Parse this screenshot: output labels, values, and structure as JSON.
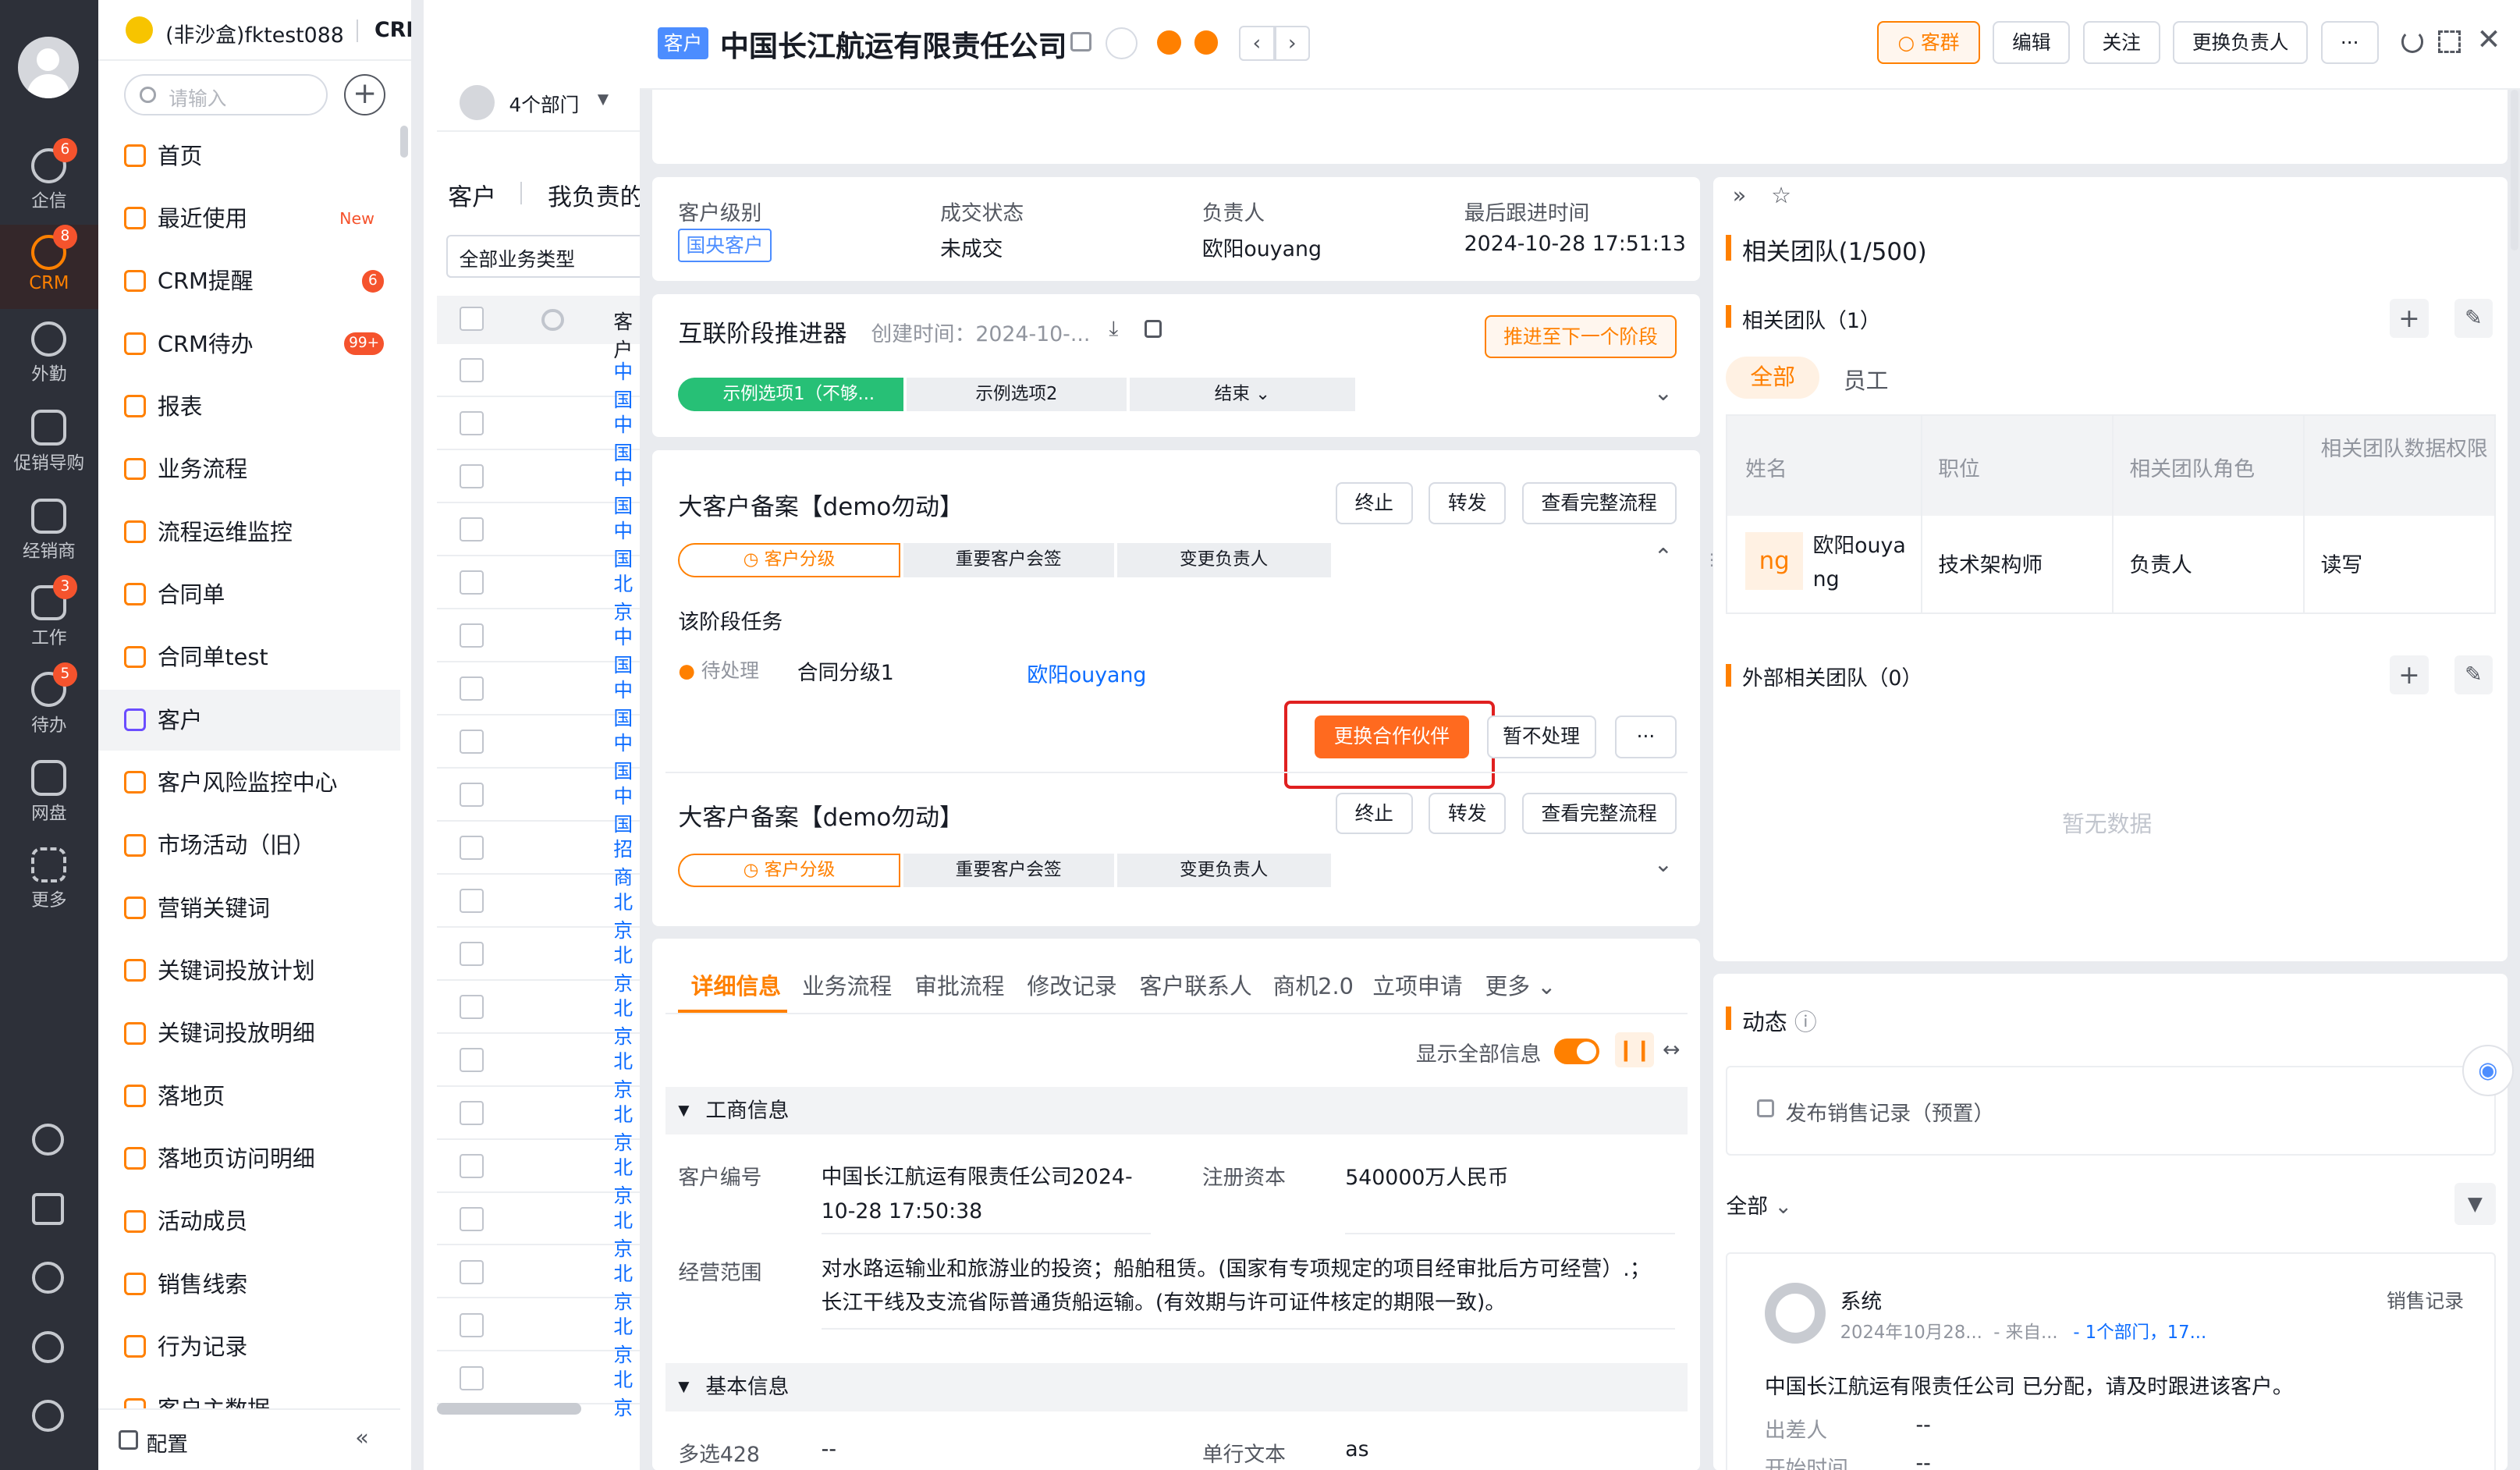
{
  "rail": {
    "items": [
      {
        "label": "企信",
        "badge": "6"
      },
      {
        "label": "CRM",
        "badge": "8"
      },
      {
        "label": "外勤",
        "badge": ""
      },
      {
        "label": "促销导购",
        "badge": ""
      },
      {
        "label": "经销商",
        "badge": ""
      },
      {
        "label": "工作",
        "badge": "3"
      },
      {
        "label": "待办",
        "badge": "5"
      },
      {
        "label": "网盘",
        "badge": ""
      },
      {
        "label": "更多",
        "badge": ""
      }
    ]
  },
  "app": {
    "tenant": "(非沙盒)fktest088",
    "module": "CRM"
  },
  "nav": {
    "search_placeholder": "请输入",
    "config_label": "配置",
    "items": [
      {
        "label": "首页",
        "badge": ""
      },
      {
        "label": "最近使用",
        "badge": "New"
      },
      {
        "label": "CRM提醒",
        "badge": "6"
      },
      {
        "label": "CRM待办",
        "badge": "99+"
      },
      {
        "label": "报表",
        "badge": ""
      },
      {
        "label": "业务流程",
        "badge": ""
      },
      {
        "label": "流程运维监控",
        "badge": ""
      },
      {
        "label": "合同单",
        "badge": ""
      },
      {
        "label": "合同单test",
        "badge": ""
      },
      {
        "label": "客户",
        "badge": ""
      },
      {
        "label": "客户风险监控中心",
        "badge": ""
      },
      {
        "label": "市场活动（旧）",
        "badge": ""
      },
      {
        "label": "营销关键词",
        "badge": ""
      },
      {
        "label": "关键词投放计划",
        "badge": ""
      },
      {
        "label": "关键词投放明细",
        "badge": ""
      },
      {
        "label": "落地页",
        "badge": ""
      },
      {
        "label": "落地页访问明细",
        "badge": ""
      },
      {
        "label": "活动成员",
        "badge": ""
      },
      {
        "label": "销售线索",
        "badge": ""
      },
      {
        "label": "行为记录",
        "badge": ""
      },
      {
        "label": "客户主数据",
        "badge": ""
      }
    ]
  },
  "list": {
    "dept_filter": "4个部门",
    "tab_customer": "客户",
    "tab_mine": "我负责的",
    "type_filter": "全部业务类型",
    "col_header": "客户",
    "rows": [
      "中国",
      "中国",
      "中国",
      "中国",
      "北京",
      "中国",
      "中国",
      "中国",
      "中国",
      "招商",
      "北京",
      "北京",
      "北京",
      "北京",
      "北京",
      "北京",
      "北京",
      "北京",
      "北京",
      "北京"
    ]
  },
  "header": {
    "type_tag": "客户",
    "title": "中国长江航运有限责任公司",
    "buttons": {
      "group": "客群",
      "edit": "编辑",
      "follow": "关注",
      "change_owner": "更换负责人",
      "more": "···"
    }
  },
  "summary": {
    "level_label": "客户级别",
    "level_value": "国央客户",
    "status_label": "成交状态",
    "status_value": "未成交",
    "owner_label": "负责人",
    "owner_value": "欧阳ouyang",
    "last_label": "最后跟进时间",
    "last_value": "2024-10-28 17:51:13"
  },
  "stage_pusher": {
    "title": "互联阶段推进器",
    "created": "创建时间：2024-10-...",
    "next_button": "推进至下一个阶段",
    "stages": [
      "示例选项1（不够...",
      "示例选项2",
      "结束"
    ]
  },
  "flow1": {
    "title": "大客户备案【demo勿动】",
    "terminate": "终止",
    "forward": "转发",
    "view_full": "查看完整流程",
    "stages": [
      "客户分级",
      "重要客户会签",
      "变更负责人"
    ],
    "task_title": "该阶段任务",
    "task_status": "待处理",
    "task_name": "合同分级1",
    "task_owner": "欧阳ouyang",
    "change_partner": "更换合作伙伴",
    "skip": "暂不处理",
    "more": "···"
  },
  "flow2": {
    "title": "大客户备案【demo勿动】",
    "terminate": "终止",
    "forward": "转发",
    "view_full": "查看完整流程",
    "stages": [
      "客户分级",
      "重要客户会签",
      "变更负责人"
    ]
  },
  "tabs": [
    "详细信息",
    "业务流程",
    "审批流程",
    "修改记录",
    "客户联系人",
    "商机2.0",
    "立项申请",
    "更多"
  ],
  "detail": {
    "show_all": "显示全部信息",
    "sec_business": "工商信息",
    "sec_basic": "基本信息",
    "customer_no_label": "客户编号",
    "customer_no_value": "中国长江航运有限责任公司2024-10-28 17:50:38",
    "capital_label": "注册资本",
    "capital_value": "540000万人民币",
    "scope_label": "经营范围",
    "scope_value": "对水路运输业和旅游业的投资；船舶租赁。(国家有专项规定的项目经审批后方可经营）.；长江干线及支流省际普通货船运输。(有效期与许可证件核定的期限一致)。",
    "multi_label": "多选428",
    "multi_value": "--",
    "text_label": "单行文本",
    "text_value": "as"
  },
  "team": {
    "title": "相关团队(1/500)",
    "sub_title": "相关团队（1）",
    "tab_all": "全部",
    "tab_emp": "员工",
    "cols": [
      "姓名",
      "职位",
      "相关团队角色",
      "相关团队数据权限"
    ],
    "row": {
      "avatar": "ng",
      "name": "欧阳ouyang",
      "position": "技术架构师",
      "role": "负责人",
      "perm": "读写"
    },
    "external": "外部相关团队（0）",
    "empty": "暂无数据"
  },
  "feed": {
    "title": "动态",
    "post": "发布销售记录（预置）",
    "filter": "全部",
    "item": {
      "author": "系统",
      "meta": "2024年10月28...  - 来自...",
      "dept": "- 1个部门，17...",
      "tag": "销售记录",
      "content": "中国长江航运有限责任公司 已分配，请及时跟进该客户。",
      "f1_label": "出差人",
      "f1_value": "--",
      "f2_label": "开始时间",
      "f2_value": "--"
    }
  },
  "colors": {
    "accent": "#ff8000",
    "highlight": "#e02020",
    "link": "#0c6cff",
    "green": "#27c076"
  }
}
